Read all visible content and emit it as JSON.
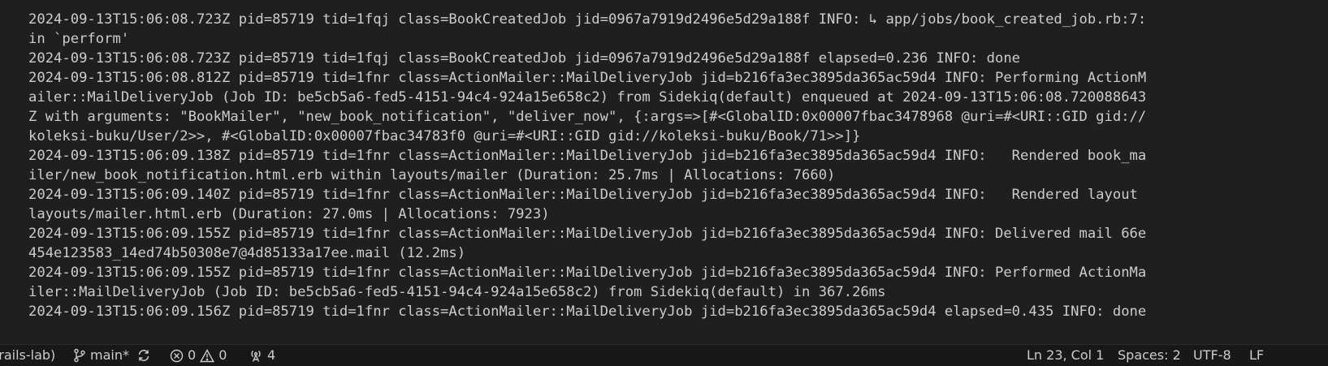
{
  "terminal": {
    "lines": [
      "2024-09-13T15:06:08.723Z pid=85719 tid=1fqj class=BookCreatedJob jid=0967a7919d2496e5d29a188f INFO: ↳ app/jobs/book_created_job.rb:7:",
      "in `perform'",
      "2024-09-13T15:06:08.723Z pid=85719 tid=1fqj class=BookCreatedJob jid=0967a7919d2496e5d29a188f elapsed=0.236 INFO: done",
      "2024-09-13T15:06:08.812Z pid=85719 tid=1fnr class=ActionMailer::MailDeliveryJob jid=b216fa3ec3895da365ac59d4 INFO: Performing ActionM",
      "ailer::MailDeliveryJob (Job ID: be5cb5a6-fed5-4151-94c4-924a15e658c2) from Sidekiq(default) enqueued at 2024-09-13T15:06:08.720088643",
      "Z with arguments: \"BookMailer\", \"new_book_notification\", \"deliver_now\", {:args=>[#<GlobalID:0x00007fbac3478968 @uri=#<URI::GID gid://",
      "koleksi-buku/User/2>>, #<GlobalID:0x00007fbac34783f0 @uri=#<URI::GID gid://koleksi-buku/Book/71>>]}",
      "2024-09-13T15:06:09.138Z pid=85719 tid=1fnr class=ActionMailer::MailDeliveryJob jid=b216fa3ec3895da365ac59d4 INFO:   Rendered book_ma",
      "iler/new_book_notification.html.erb within layouts/mailer (Duration: 25.7ms | Allocations: 7660)",
      "2024-09-13T15:06:09.140Z pid=85719 tid=1fnr class=ActionMailer::MailDeliveryJob jid=b216fa3ec3895da365ac59d4 INFO:   Rendered layout",
      "layouts/mailer.html.erb (Duration: 27.0ms | Allocations: 7923)",
      "2024-09-13T15:06:09.155Z pid=85719 tid=1fnr class=ActionMailer::MailDeliveryJob jid=b216fa3ec3895da365ac59d4 INFO: Delivered mail 66e",
      "454e123583_14ed74b50308e7@4d85133a17ee.mail (12.2ms)",
      "2024-09-13T15:06:09.155Z pid=85719 tid=1fnr class=ActionMailer::MailDeliveryJob jid=b216fa3ec3895da365ac59d4 INFO: Performed ActionMa",
      "iler::MailDeliveryJob (Job ID: be5cb5a6-fed5-4151-94c4-924a15e658c2) from Sidekiq(default) in 367.26ms",
      "2024-09-13T15:06:09.156Z pid=85719 tid=1fnr class=ActionMailer::MailDeliveryJob jid=b216fa3ec3895da365ac59d4 elapsed=0.435 INFO: done"
    ]
  },
  "statusbar": {
    "remote_label": "(rails-lab)",
    "branch": "main*",
    "errors": "0",
    "warnings": "0",
    "ports": "4",
    "position": "Ln 23, Col 1",
    "indent": "Spaces: 2",
    "encoding": "UTF-8",
    "eol": "LF"
  },
  "colors": {
    "background": "#1f1f1f",
    "text": "#cccccc",
    "cursor": "#4aa3ff",
    "statusbar": "#181818"
  }
}
